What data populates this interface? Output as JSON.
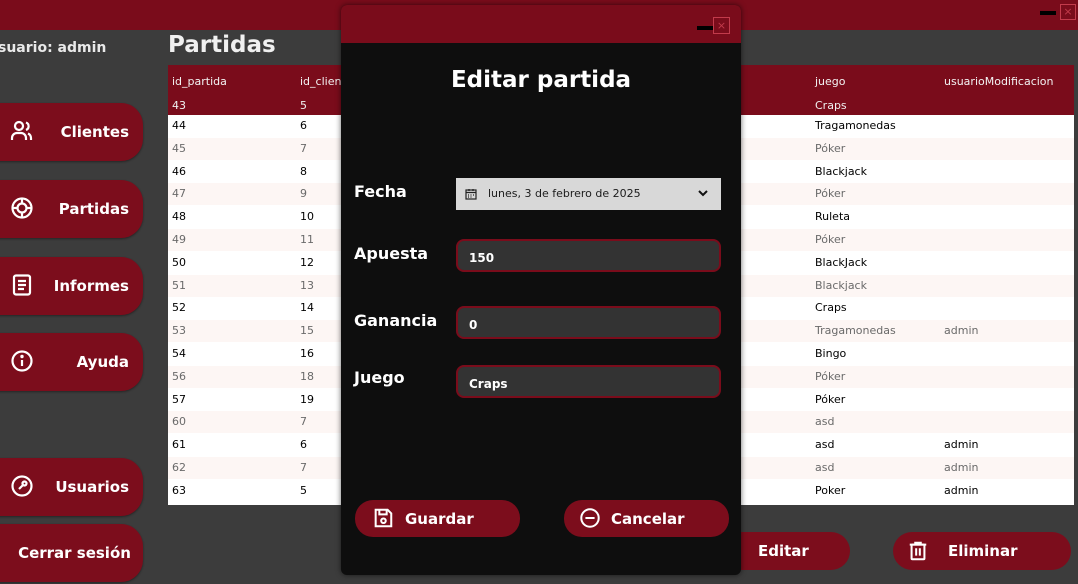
{
  "sidebar": {
    "user_label": "suario: admin",
    "buttons": [
      "Clientes",
      "Partidas",
      "Informes",
      "Ayuda",
      "Usuarios",
      "Cerrar sesión"
    ]
  },
  "main": {
    "title": "Partidas"
  },
  "table": {
    "headers": [
      "id_partida",
      "id_client",
      "juego",
      "usuarioModificacion"
    ],
    "rows": [
      [
        "43",
        "5",
        "Craps",
        ""
      ],
      [
        "44",
        "6",
        "Tragamonedas",
        ""
      ],
      [
        "45",
        "7",
        "Póker",
        ""
      ],
      [
        "46",
        "8",
        "Blackjack",
        ""
      ],
      [
        "47",
        "9",
        "Póker",
        ""
      ],
      [
        "48",
        "10",
        "Ruleta",
        ""
      ],
      [
        "49",
        "11",
        "Póker",
        ""
      ],
      [
        "50",
        "12",
        "BlackJack",
        ""
      ],
      [
        "51",
        "13",
        "Blackjack",
        ""
      ],
      [
        "52",
        "14",
        "Craps",
        ""
      ],
      [
        "53",
        "15",
        "Tragamonedas",
        "admin"
      ],
      [
        "54",
        "16",
        "Bingo",
        ""
      ],
      [
        "56",
        "18",
        "Póker",
        ""
      ],
      [
        "57",
        "19",
        "Póker",
        ""
      ],
      [
        "60",
        "7",
        "asd",
        ""
      ],
      [
        "61",
        "6",
        "asd",
        "admin"
      ],
      [
        "62",
        "7",
        "asd",
        "admin"
      ],
      [
        "63",
        "5",
        "Poker",
        "admin"
      ]
    ]
  },
  "modal": {
    "title": "Editar partida",
    "labels": {
      "fecha": "Fecha",
      "apuesta": "Apuesta",
      "ganancia": "Ganancia",
      "juego": "Juego"
    },
    "values": {
      "fecha": "lunes, 3 de febrero de 2025",
      "apuesta": "150",
      "ganancia": "0",
      "juego": "Craps"
    },
    "buttons": {
      "save": "Guardar",
      "cancel": "Cancelar"
    }
  },
  "actions": {
    "edit": "Editar",
    "delete": "Eliminar"
  },
  "colors": {
    "accent": "#7c0d1c",
    "background": "#3c3c3c",
    "modal": "#0e0e0e"
  }
}
